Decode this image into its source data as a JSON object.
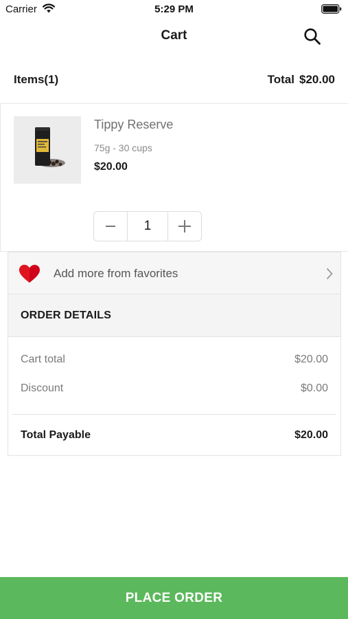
{
  "status_bar": {
    "carrier": "Carrier",
    "time": "5:29 PM"
  },
  "nav": {
    "title": "Cart",
    "search_icon": "search-icon"
  },
  "summary": {
    "items_label": "Items(1)",
    "total_label": "Total",
    "total_value": "$20.00"
  },
  "cart_items": [
    {
      "name": "Tippy Reserve",
      "variant": "75g - 30 cups",
      "price": "$20.00",
      "quantity": "1"
    }
  ],
  "favorites": {
    "label": "Add more from favorites",
    "icon": "heart-icon"
  },
  "order_details": {
    "title": "ORDER DETAILS",
    "rows": [
      {
        "label": "Cart total",
        "value": "$20.00"
      },
      {
        "label": "Discount",
        "value": "$0.00"
      }
    ],
    "payable_label": "Total Payable",
    "payable_value": "$20.00"
  },
  "place_order_label": "PLACE ORDER",
  "colors": {
    "accent": "#5cb85c",
    "heart": "#d0021b"
  }
}
